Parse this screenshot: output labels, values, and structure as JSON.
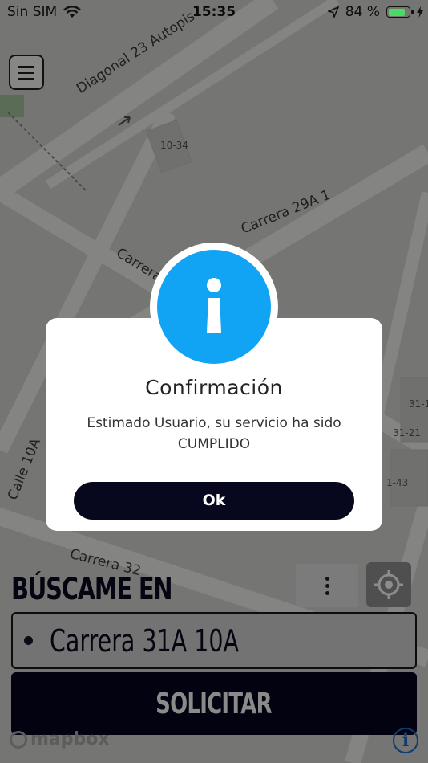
{
  "status_bar": {
    "carrier": "Sin SIM",
    "time": "15:35",
    "battery_percent": "84 %",
    "battery_level": 0.84,
    "battery_color": "#4cd964"
  },
  "map": {
    "streets": [
      "Diagonal 23 Autopis",
      "Carrera 29A 1",
      "Carrera",
      "Calle 10A",
      "Carrera 32"
    ],
    "blocks": [
      "10-34",
      "31-1",
      "31-21",
      "1-43"
    ],
    "logo": "mapbox",
    "attribution_icon": "i"
  },
  "menu": {
    "icon": "hamburger-icon"
  },
  "modal": {
    "icon": "info-icon",
    "icon_color": "#11a4f4",
    "title": "Confirmación",
    "message": "Estimado Usuario, su servicio ha sido CUMPLIDO",
    "ok_label": "Ok"
  },
  "pickup": {
    "section_title": "BÚSCAME EN",
    "address": "Carrera 31A 10A",
    "request_label": "SOLICITAR"
  },
  "colors": {
    "primary_dark": "#050512",
    "accent_blue": "#11a4f4"
  }
}
